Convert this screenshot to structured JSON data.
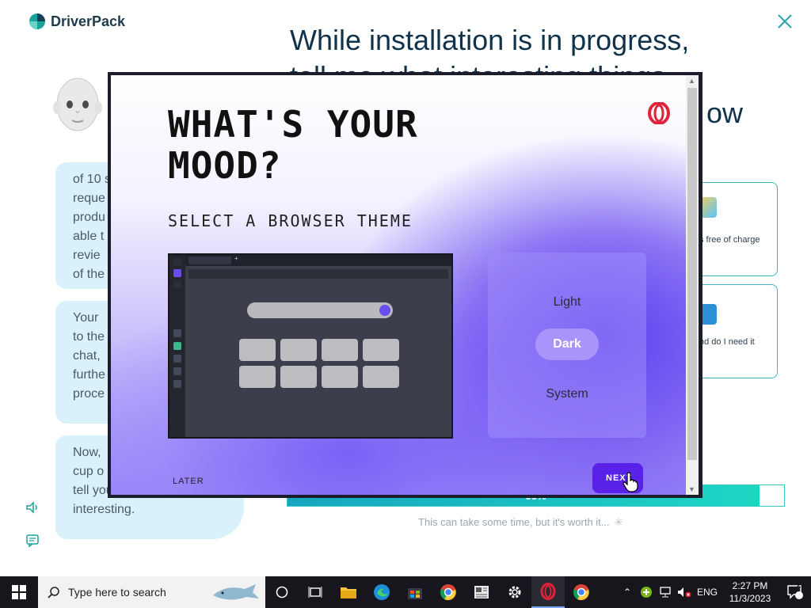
{
  "driverpack": {
    "logo_text": "DriverPack",
    "heading_line1": "While installation is in progress,",
    "heading_line2": "tell me what interesting things",
    "heading_fragment": "ow",
    "bubbles": [
      "of 10 s\nreque\nprodu\nable t\nrevie\nof the",
      "Your\nto the\nchat,\nfurthe\nproce",
      "Now,\ncup o\ntell you something\ninteresting."
    ],
    "cards": [
      {
        "text": "s free of charge",
        "icon": "monitor-icon"
      },
      {
        "text": "nd do I need it",
        "icon": "laptop-icon"
      }
    ],
    "progress": {
      "percent": 95,
      "label": "95%"
    },
    "note": "This can take some time, but it's worth it..."
  },
  "dialog": {
    "title": "WHAT'S YOUR\nMOOD?",
    "subtitle": "SELECT A BROWSER THEME",
    "themes": {
      "light": "Light",
      "dark": "Dark",
      "system": "System",
      "selected": "Dark"
    },
    "later_label": "LATER",
    "next_label": "NEXT",
    "accent_color": "#5a22e8"
  },
  "taskbar": {
    "search_placeholder": "Type here to search",
    "language": "ENG",
    "time": "2:27 PM",
    "date": "11/3/2023",
    "notification_count": "2"
  }
}
